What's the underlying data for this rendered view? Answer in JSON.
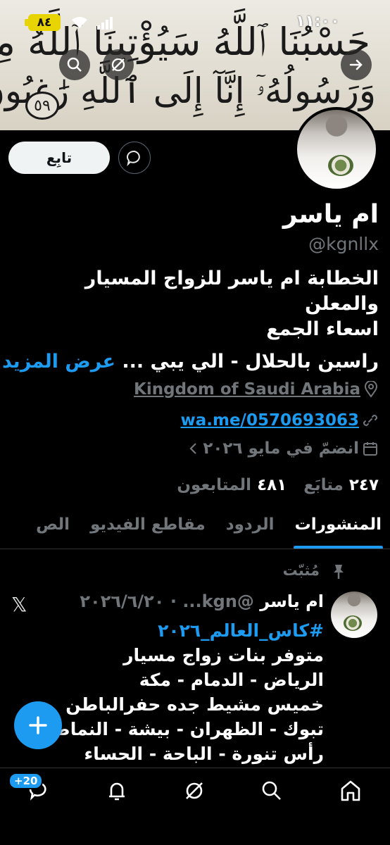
{
  "status_bar": {
    "time": "١١:٠٠",
    "battery": "٨٤"
  },
  "banner": {
    "calligraphy_line1": "حَسْبُنَا ٱللَّهُ سَيُؤْتِينَا ٱللَّهُ مِن فَضْلِهِۦ",
    "calligraphy_line2": "وَرَسُولُهُۥٓ إِنَّآ إِلَى ٱللَّهِ رَٰغِبُونَ",
    "verse_number": "٥٩"
  },
  "header_icons": [
    "back-arrow-icon",
    "search-icon",
    "grok-icon"
  ],
  "profile": {
    "follow_label": "تابِع",
    "name": "ام ياسر",
    "handle": "@kgnllx",
    "bio_line1": "الخطابة ام ياسر للزواج المسيار والمعلن",
    "bio_line2": "اسعاء الجمع",
    "bio_line3": "راسين بالحلال - الي يبي ...",
    "show_more": "عرض المزيد",
    "location": "Kingdom of Saudi Arabia",
    "link": "wa.me/0570693063",
    "joined": "انضمّ في مايو ٢٠٢٦",
    "following_count": "٢٤٧",
    "following_label": "متابَع",
    "followers_count": "٤٨١",
    "followers_label": "المتابعون"
  },
  "tabs": [
    {
      "label": "المنشورات",
      "active": true
    },
    {
      "label": "الردود",
      "active": false
    },
    {
      "label": "مقاطع الفيديو",
      "active": false
    },
    {
      "label": "الص",
      "active": false
    }
  ],
  "post": {
    "pinned_label": "مُثبّت",
    "author": "ام ياسر",
    "meta": "@kgn... · ٢٠٢٦/٦/٢٠",
    "hashtag": "#كاس_العالم_٢٠٢٦",
    "lines": [
      "متوفر بنات زواج مسيار",
      "الرياض - الدمام - مكة",
      "خميس مشيط جده حفرالباطن",
      "تبوك - الظهران - بيشة - النماص",
      "رأس تنورة - الباحة - الحساء"
    ]
  },
  "bottom_nav": {
    "items": [
      "home-icon",
      "search-icon",
      "grok-icon",
      "notifications-icon",
      "messages-icon"
    ],
    "badge": "+20"
  },
  "colors": {
    "accent": "#1d9bf0",
    "background": "#000000",
    "muted": "#71767b",
    "battery": "#e8d400"
  }
}
